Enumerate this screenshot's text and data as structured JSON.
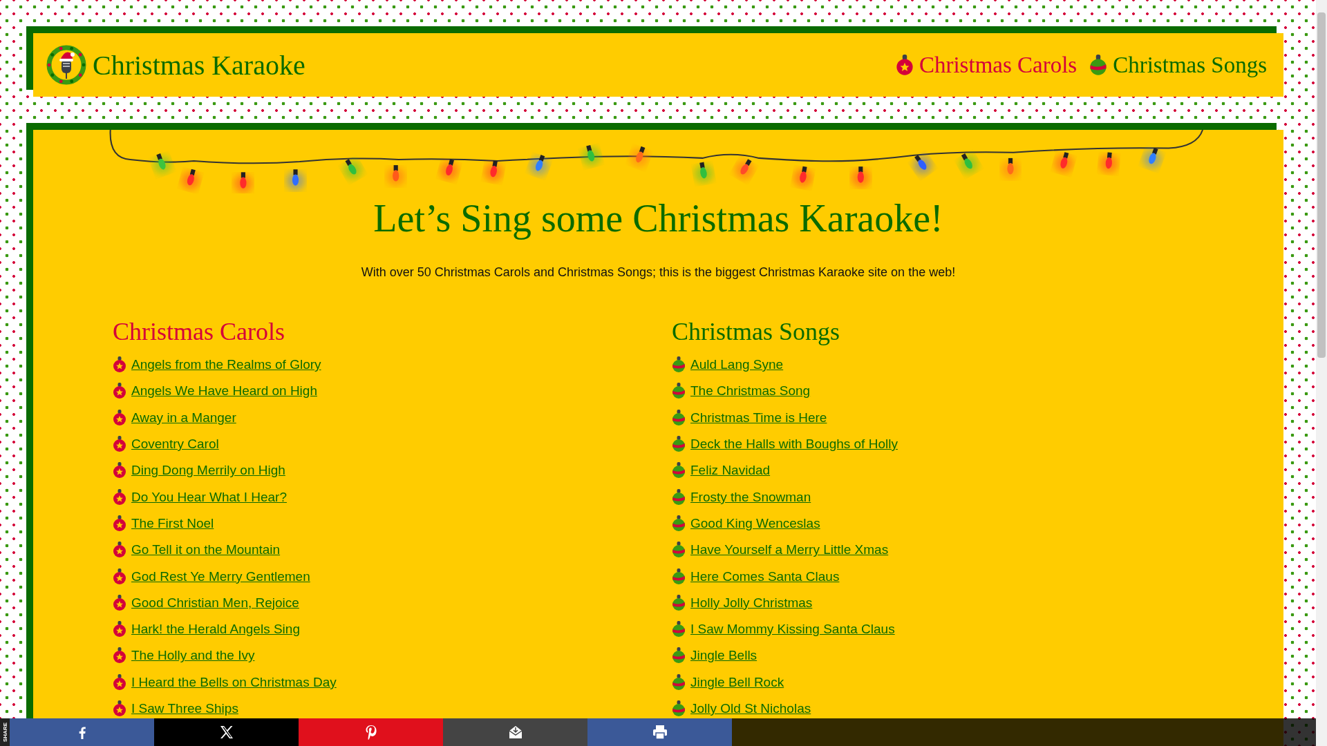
{
  "header": {
    "brand": "Christmas Karaoke",
    "nav": [
      {
        "label": "Christmas Carols",
        "kind": "carol"
      },
      {
        "label": "Christmas Songs",
        "kind": "song"
      }
    ]
  },
  "main": {
    "title": "Let’s Sing some Christmas Karaoke!",
    "intro": "With over 50 Christmas Carols and Christmas Songs; this is the biggest Christmas Karaoke site on the web!",
    "columns": [
      {
        "heading": "Christmas Carols",
        "kind": "carol",
        "items": [
          "Angels from the Realms of Glory",
          "Angels We Have Heard on High",
          "Away in a Manger",
          "Coventry Carol",
          "Ding Dong Merrily on High",
          "Do You Hear What I Hear?",
          "The First Noel",
          "Go Tell it on the Mountain",
          "God Rest Ye Merry Gentlemen",
          "Good Christian Men, Rejoice",
          "Hark! the Herald Angels Sing",
          "The Holly and the Ivy",
          "I Heard the Bells on Christmas Day",
          "I Saw Three Ships"
        ]
      },
      {
        "heading": "Christmas Songs",
        "kind": "song",
        "items": [
          "Auld Lang Syne",
          "The Christmas Song",
          "Christmas Time is Here",
          "Deck the Halls with Boughs of Holly",
          "Feliz Navidad",
          "Frosty the Snowman",
          "Good King Wenceslas",
          "Have Yourself a Merry Little Xmas",
          "Here Comes Santa Claus",
          "Holly Jolly Christmas",
          "I Saw Mommy Kissing Santa Claus",
          "Jingle Bells",
          "Jingle Bell Rock",
          "Jolly Old St Nicholas"
        ]
      }
    ]
  },
  "share": {
    "label": "SHARE",
    "buttons": [
      {
        "kind": "facebook"
      },
      {
        "kind": "x"
      },
      {
        "kind": "pinterest"
      },
      {
        "kind": "email"
      },
      {
        "kind": "print"
      }
    ]
  }
}
